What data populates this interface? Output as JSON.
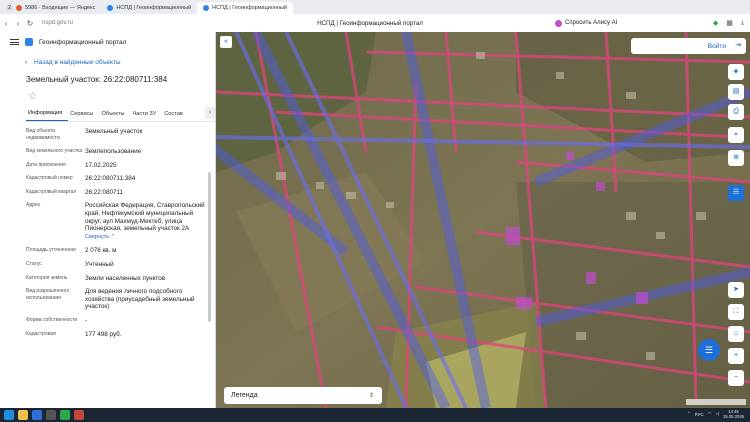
{
  "browser": {
    "tabs": [
      {
        "badge": "2",
        "label": "5986 · Входящие — Яндекс"
      },
      {
        "label": "НСПД | Геоинформационный"
      },
      {
        "label": "НСПД | Геоинформационный"
      }
    ],
    "address": "nspd.gov.ru",
    "page_title": "НСПД | Геоинформационный портал",
    "alice": "Спросить Алису AI"
  },
  "portal": {
    "name": "Геоинформационный портал",
    "back": "Назад в найденные объекты",
    "object_title": "Земельный участок: 26:22:080711:384",
    "tabs": [
      "Информация",
      "Сервисы",
      "Объекты",
      "Части ЗУ",
      "Состав"
    ],
    "props": [
      {
        "k": "Вид объекта недвижимости",
        "v": "Земельный участок"
      },
      {
        "k": "Вид земельного участка",
        "v": "Землепользование"
      },
      {
        "k": "Дата присвоения",
        "v": "17.02.2025"
      },
      {
        "k": "Кадастровый номер",
        "v": "26:22:080711:384"
      },
      {
        "k": "Кадастровый квартал",
        "v": "26:22:080711"
      },
      {
        "k": "Адрес",
        "v": "Российская Федерация, Ставропольский край, Нефтекумский муниципальный округ, аул Махмуд-Мектеб, улица Пионерская, земельный участок 2А"
      },
      {
        "k": "Площадь уточненная",
        "v": "2 076 кв. м"
      },
      {
        "k": "Статус",
        "v": "Учтенный"
      },
      {
        "k": "Категория земель",
        "v": "Земли населенных пунктов"
      },
      {
        "k": "Вид разрешенного использования",
        "v": "Для ведения личного подсобного хозяйства (приусадебный земельный участок)"
      },
      {
        "k": "Форма собственности",
        "v": "-"
      },
      {
        "k": "Кадастровая",
        "v": "177 498 руб."
      }
    ],
    "collapse_link": "Свернуть"
  },
  "map": {
    "login": "Войти",
    "legend": "Легенда"
  },
  "taskbar": {
    "time": "14:45",
    "date": "15.05.2026",
    "lang": "РУС"
  },
  "colors": {
    "accent": "#1565c0",
    "parcel_pink": "#e0457e",
    "zone_blue": "#4d5cf0"
  }
}
